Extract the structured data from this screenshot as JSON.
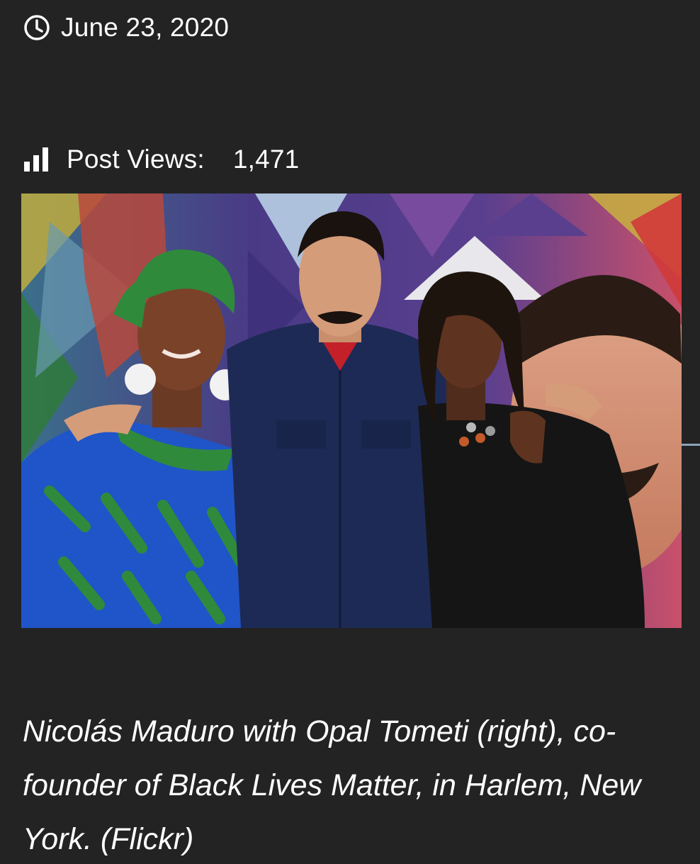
{
  "post_meta": {
    "date": "June 23, 2020",
    "date_icon": "clock-icon",
    "views_label": "Post Views:",
    "views_count": "1,471",
    "views_icon": "bar-chart-icon"
  },
  "image": {
    "colors": {
      "page_background": "#232323",
      "backdrop_purple": "#4a3a86",
      "dress_blue": "#1f55c8",
      "dress_green": "#2f8a3c",
      "jacket_navy": "#1d2a55",
      "black_dress": "#151515"
    }
  },
  "caption": {
    "text": "Nicolás Maduro with Opal Tometi (right), co-founder of Black Lives Matter, in Harlem, New York. (Flickr)"
  }
}
